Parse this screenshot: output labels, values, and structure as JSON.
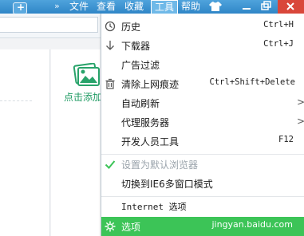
{
  "menubar": {
    "tab_plus": "+",
    "chevrons": "»",
    "items": [
      {
        "label": "文件"
      },
      {
        "label": "查看"
      },
      {
        "label": "收藏"
      },
      {
        "label": "工具"
      },
      {
        "label": "帮助"
      }
    ],
    "active_index": 3
  },
  "page": {
    "card_label": "点击添加"
  },
  "tools_menu": {
    "items": [
      {
        "label": "历史",
        "shortcut": "Ctrl+H",
        "icon": "clock-icon"
      },
      {
        "label": "下载器",
        "shortcut": "Ctrl+J",
        "icon": "download-arrow-icon"
      },
      {
        "label": "广告过滤",
        "shortcut": "",
        "icon": ""
      },
      {
        "label": "清除上网痕迹",
        "shortcut": "Ctrl+Shift+Delete",
        "icon": "trash-icon"
      },
      {
        "label": "自动刷新",
        "submenu": ">"
      },
      {
        "label": "代理服务器",
        "submenu": ">"
      },
      {
        "label": "开发人员工具",
        "shortcut": "F12"
      },
      {
        "label": "设置为默认浏览器",
        "disabled": true,
        "icon": "checkmark-icon"
      },
      {
        "label": "切换到IE6多窗口模式"
      },
      {
        "label": "Internet 选项"
      },
      {
        "label": "选项",
        "icon": "gear-icon",
        "highlighted": true
      }
    ]
  },
  "watermark": "jingyan.baidu.com",
  "colors": {
    "menubar": "#2f86c7",
    "highlight": "#3cc457",
    "accent_green": "#1e9a62"
  }
}
